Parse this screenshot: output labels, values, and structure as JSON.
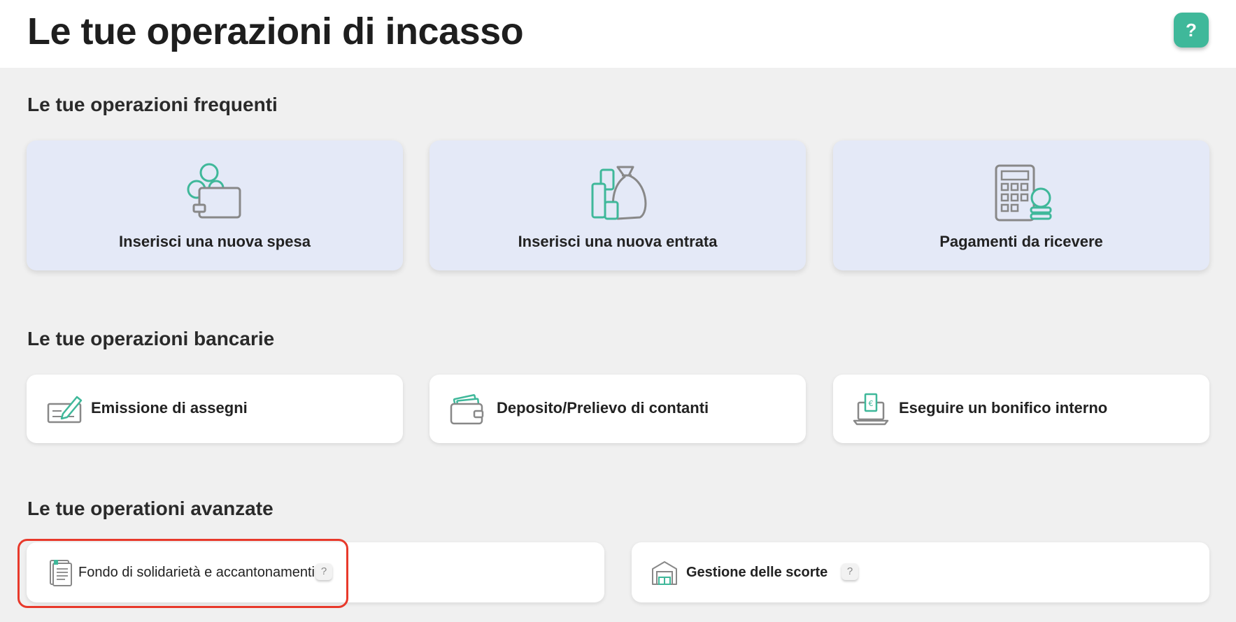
{
  "page": {
    "title": "Le tue operazioni di incasso",
    "help_label": "?"
  },
  "sections": {
    "frequent": {
      "title": "Le tue operazioni frequenti",
      "cards": [
        {
          "label": "Inserisci una nuova spesa",
          "icon": "wallet-coins-icon"
        },
        {
          "label": "Inserisci una nuova entrata",
          "icon": "money-bag-coins-icon"
        },
        {
          "label": "Pagamenti da ricevere",
          "icon": "calculator-coins-icon"
        }
      ]
    },
    "banking": {
      "title": "Le tue operazioni bancarie",
      "cards": [
        {
          "label": "Emissione di assegni",
          "icon": "check-pen-icon"
        },
        {
          "label": "Deposito/Prelievo di contanti",
          "icon": "wallet-cash-icon"
        },
        {
          "label": "Eseguire un bonifico interno",
          "icon": "laptop-transfer-icon"
        }
      ]
    },
    "advanced": {
      "title": "Le tue operationi avanzate",
      "cards": [
        {
          "label": "Fondo di solidarietà e accantonamenti",
          "icon": "document-list-icon",
          "info": "?"
        },
        {
          "label": "Gestione delle scorte",
          "icon": "warehouse-icon",
          "info": "?"
        }
      ]
    }
  },
  "colors": {
    "accent": "#3fb89a",
    "card_blue": "#e4e9f7",
    "highlight": "#e8392b",
    "background": "#f0f0f0"
  }
}
